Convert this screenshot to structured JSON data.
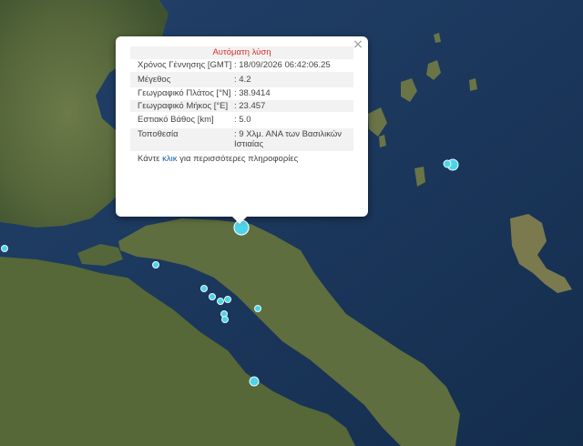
{
  "popup": {
    "title": "Αυτόματη λύση",
    "close_label": "×",
    "rows": [
      {
        "label": "Χρόνος Γέννησης [GMT]",
        "value": ": 18/09/2026 06:42:06.25"
      },
      {
        "label": "Μέγεθος",
        "value": ": 4.2"
      },
      {
        "label": "Γεωγραφικό Πλάτος [°N]",
        "value": ": 38.9414"
      },
      {
        "label": "Γεωγραφικό Μήκος [°E]",
        "value": ": 23.457"
      },
      {
        "label": "Εστιακό Βάθος [km]",
        "value": ": 5.0"
      },
      {
        "label": "Τοποθεσία",
        "value": ": 9 Χλμ. ΑΝΑ των Βασιλικών Ιστιαίας"
      }
    ],
    "footer_prefix": "Κάντε",
    "footer_link": "κλικ",
    "footer_suffix": "για περισσότερες πληροφορίες"
  },
  "colors": {
    "sea": "#1c3a5c",
    "land": "#5b6b3e",
    "marker_fill": "#4fd3e8",
    "marker_stroke": "#e6fbff",
    "title_red": "#d9302a",
    "link_blue": "#1a5fb4"
  }
}
